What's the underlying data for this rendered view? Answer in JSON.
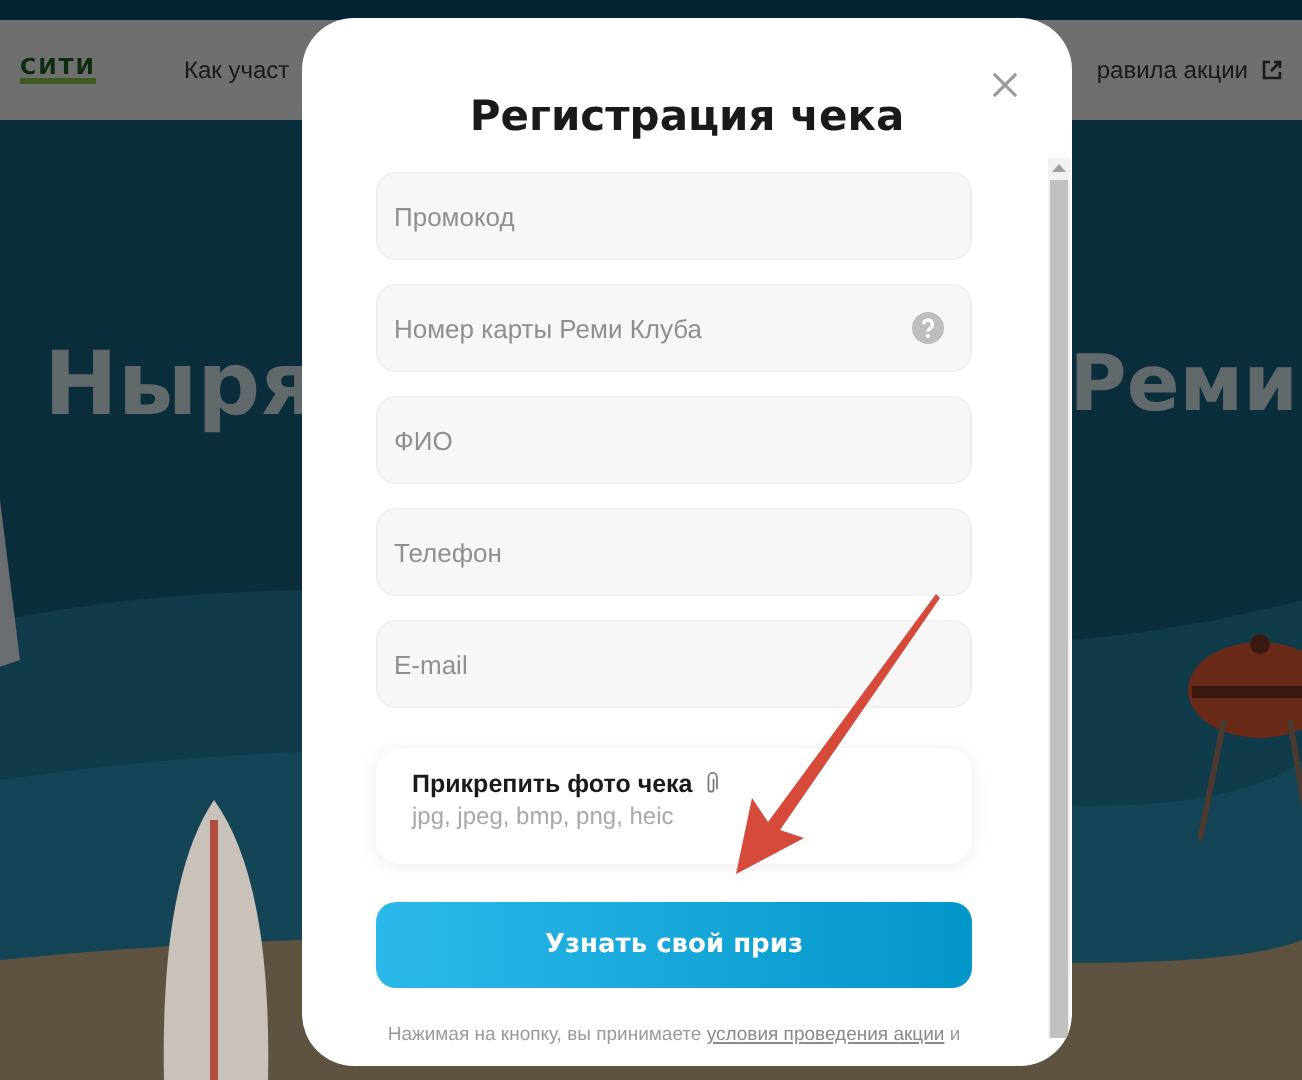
{
  "background_page": {
    "logo": "СИТИ",
    "nav": [
      {
        "label": "Как участ"
      },
      {
        "label": "равила акции",
        "external": true
      }
    ],
    "headline_parts": [
      "Ныря",
      "Реми"
    ]
  },
  "modal": {
    "title": "Регистрация чека",
    "fields": [
      {
        "placeholder": "Промокод",
        "help": false
      },
      {
        "placeholder": "Номер карты Реми Клуба",
        "help": true
      },
      {
        "placeholder": "ФИО",
        "help": false
      },
      {
        "placeholder": "Телефон",
        "help": false
      },
      {
        "placeholder": "E-mail",
        "help": false
      }
    ],
    "upload": {
      "label": "Прикрепить фото чека",
      "hint": "jpg, jpeg, bmp, png, heic"
    },
    "submit": "Узнать свой приз",
    "consent": {
      "text": "Нажимая на кнопку, вы принимаете ",
      "link": "условия проведения акции",
      "tail": " и"
    }
  }
}
